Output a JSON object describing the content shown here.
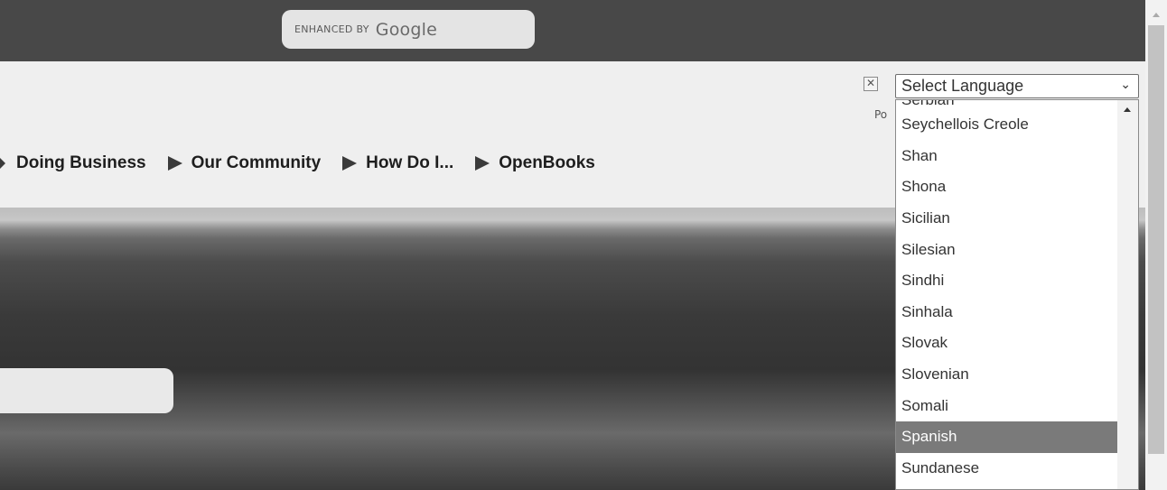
{
  "search": {
    "enhanced_by": "ENHANCED BY",
    "brand": "Google"
  },
  "nav": {
    "items": [
      {
        "label": "Doing Business"
      },
      {
        "label": "Our Community"
      },
      {
        "label": "How Do I..."
      },
      {
        "label": "OpenBooks"
      }
    ]
  },
  "translate": {
    "close_icon": "close-icon",
    "powered_text": "Po",
    "select_value": "Select Language",
    "options_partial_top": "Serbian",
    "options": [
      "Seychellois Creole",
      "Shan",
      "Shona",
      "Sicilian",
      "Silesian",
      "Sindhi",
      "Sinhala",
      "Slovak",
      "Slovenian",
      "Somali",
      "Spanish",
      "Sundanese"
    ],
    "selected_option": "Spanish"
  },
  "colors": {
    "topbar": "#484848",
    "header": "#efefef",
    "selected_option_bg": "#7a7a7a"
  }
}
